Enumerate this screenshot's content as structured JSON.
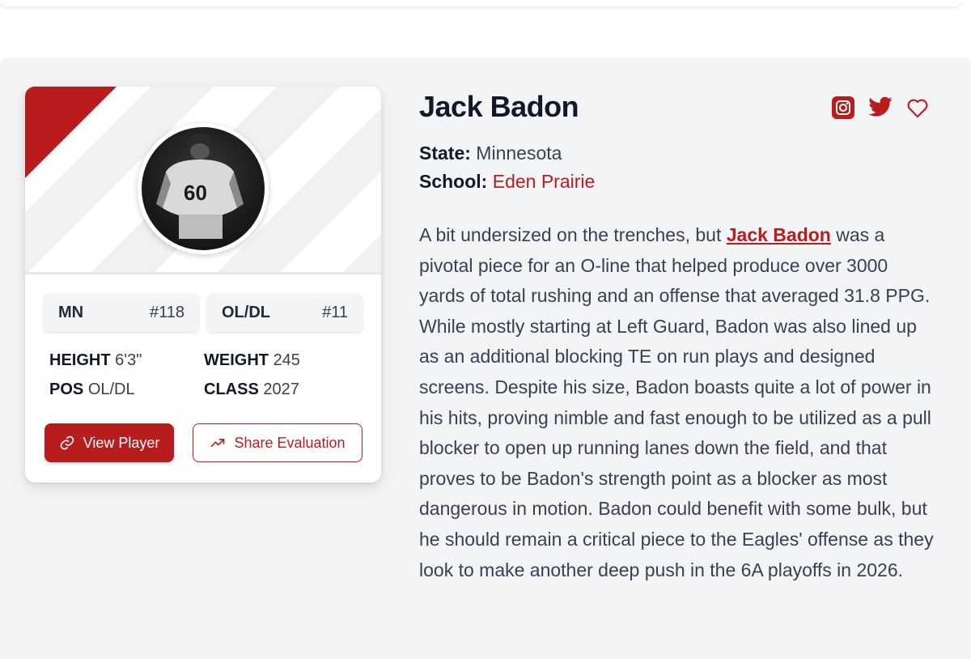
{
  "player": {
    "name": "Jack Badon",
    "state_label": "State:",
    "state": "Minnesota",
    "school_label": "School:",
    "school": "Eden Prairie"
  },
  "card": {
    "state_rank": {
      "label": "MN",
      "value": "#118"
    },
    "position_rank": {
      "label": "OL/DL",
      "value": "#11"
    },
    "stats": {
      "height_label": "HEIGHT",
      "height": "6'3\"",
      "weight_label": "WEIGHT",
      "weight": "245",
      "pos_label": "POS",
      "pos": "OL/DL",
      "class_label": "CLASS",
      "class": "2027"
    },
    "view_button": "View Player",
    "share_button": "Share Evaluation"
  },
  "social": {
    "icons": [
      "instagram-icon",
      "twitter-icon",
      "heart-icon"
    ]
  },
  "bio": {
    "before": "A bit undersized on the trenches, but ",
    "link": "Jack Badon",
    "after": " was a pivotal piece for an O-line that helped produce over 3000 yards of total rushing and an offense that averaged 31.8 PPG. While mostly starting at Left Guard, Badon was also lined up as an additional blocking TE on run plays and designed screens. Despite his size, Badon boasts quite a lot of power in his hits, proving nimble and fast enough to be utilized as a pull blocker to open up running lanes down the field, and that proves to be Badon's strength point as a blocker as most dangerous in motion. Badon could benefit with some bulk, but he should remain a critical piece to the Eagles' offense as they look to make another deep push in the 6A playoffs in 2026."
  },
  "colors": {
    "accent": "#b91c1c",
    "background": "#f3f4f6",
    "card": "#ffffff"
  }
}
